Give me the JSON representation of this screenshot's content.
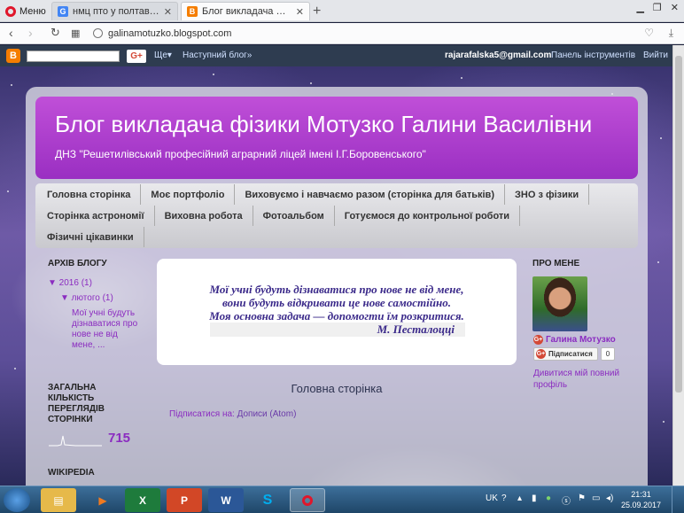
{
  "browser": {
    "menu_label": "Меню",
    "tabs": [
      {
        "title": "нмц пто у полтавській об",
        "favicon_color": "#4285f4",
        "active": false
      },
      {
        "title": "Блог викладача фізики М",
        "favicon_color": "#f57d00",
        "active": true
      }
    ],
    "url": "galinamotuzko.blogspot.com"
  },
  "blogger_nav": {
    "more_label": "Ще▾",
    "next_blog": "Наступний блог»",
    "user_email": "rajarafalska5@gmail.com",
    "dashboard": "Панель інструментів",
    "sign_out": "Вийти",
    "gplus_label": "G+"
  },
  "header": {
    "title": "Блог викладача фізики Мотузко Галини Василівни",
    "subtitle": "ДНЗ \"Решетилівський професійний аграрний ліцей імені І.Г.Боровенського\""
  },
  "page_tabs": {
    "row1": [
      "Головна сторінка",
      "Моє портфоліо",
      "Виховуємо і навчаємо разом (сторінка для батьків)",
      "ЗНО з фізики"
    ],
    "row2": [
      "Сторінка астрономії",
      "Виховна робота",
      "Фотоальбом",
      "Готуємося до контрольної роботи"
    ],
    "row3": [
      "Фізичні цікавинки"
    ]
  },
  "left_sidebar": {
    "archive_heading": "АРХІВ БЛОГУ",
    "year": "▼  2016 (1)",
    "month": "▼  лютого (1)",
    "post": "Мої учні будуть дізнаватися про нове не від мене, ...",
    "views_heading": "ЗАГАЛЬНА КІЛЬКІСТЬ ПЕРЕГЛЯДІВ СТОРІНКИ",
    "views_count": "715",
    "wiki_heading": "WIKIPEDIA"
  },
  "quote": {
    "line1": "Мої учні будуть дізнаватися про нове не від мене,",
    "line2": "вони будуть відкривати це нове самостійно.",
    "line3": "Моя основна задача — допомогти їм розкритися.",
    "author": "М. Песталоцці"
  },
  "main": {
    "page_title": "Головна сторінка",
    "subscribe_label": "Підписатися на:",
    "subscribe_link": "Дописи (Atom)"
  },
  "right_sidebar": {
    "heading": "ПРО МЕНЕ",
    "name": "Галина Мотузко",
    "follow_label": "Підписатися",
    "follow_count": "0",
    "profile_link": "Дивитися мій повний профіль"
  },
  "taskbar": {
    "lang": "UK",
    "time": "21:31",
    "date": "25.09.2017"
  }
}
